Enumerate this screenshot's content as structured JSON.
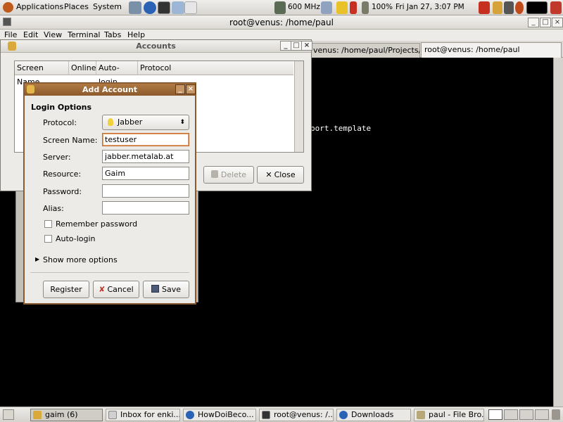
{
  "top_panel": {
    "menus": [
      "Applications",
      "Places",
      "System"
    ],
    "cpu": "600 MHz",
    "battery": "100%",
    "clock": "Fri Jan 27,  3:07 PM"
  },
  "terminal": {
    "title": "root@venus: /home/paul",
    "menu": [
      "File",
      "Edit",
      "View",
      "Terminal",
      "Tabs",
      "Help"
    ],
    "tabs": [
      "venus: /home/paul/Projects/m...",
      "root@venus: /home/paul"
    ],
    "visible_line": "port.template"
  },
  "accounts": {
    "title": "Accounts",
    "columns": [
      "Screen Name",
      "Online",
      "Auto-login",
      "Protocol"
    ],
    "buttons": {
      "delete": "Delete",
      "close": "Close"
    }
  },
  "add_account": {
    "title": "Add Account",
    "section": "Login Options",
    "labels": {
      "protocol": "Protocol:",
      "screen_name": "Screen Name:",
      "server": "Server:",
      "resource": "Resource:",
      "password": "Password:",
      "alias": "Alias:"
    },
    "values": {
      "protocol": "Jabber",
      "screen_name": "testuser",
      "server": "jabber.metalab.at",
      "resource": "Gaim",
      "password": "",
      "alias": ""
    },
    "checks": {
      "remember_password": {
        "label": "Remember password",
        "checked": false
      },
      "auto_login": {
        "label": "Auto-login",
        "checked": false
      }
    },
    "expander": "Show more options",
    "buttons": {
      "register": "Register",
      "cancel": "Cancel",
      "save": "Save"
    }
  },
  "taskbar": {
    "items": [
      {
        "label": "gaim (6)",
        "active": true
      },
      {
        "label": "Inbox for enki...",
        "active": false
      },
      {
        "label": "HowDoiBeco...",
        "active": false
      },
      {
        "label": "root@venus: /...",
        "active": false
      },
      {
        "label": "Downloads",
        "active": false
      },
      {
        "label": "paul - File Bro...",
        "active": false
      }
    ]
  },
  "colors": {
    "dialog_title": "#8c5a2c",
    "terminal_bg": "#000000",
    "panel": "#dcd9d4"
  }
}
